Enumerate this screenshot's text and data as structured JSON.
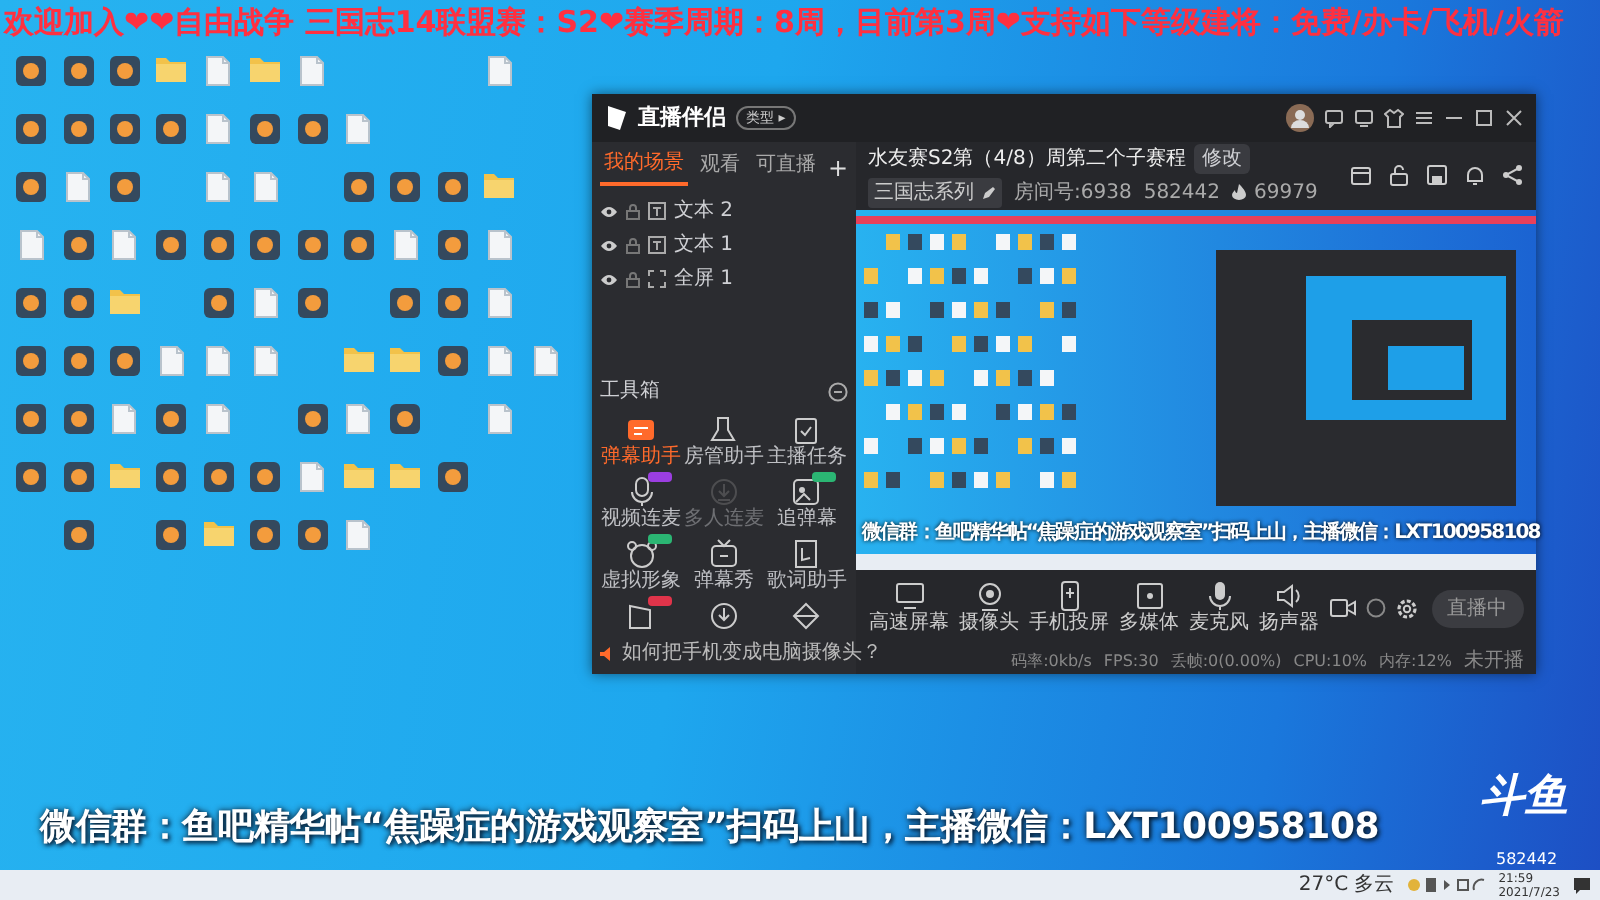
{
  "banner": "欢迎加入❤❤自由战争 三国志14联盟赛：S2❤赛季周期：8周，目前第3周❤支持如下等级建将：免费/办卡/飞机/火箭",
  "desktop_icons": [
    [
      {
        "kind": "app"
      },
      {
        "kind": "app"
      },
      {
        "kind": "app"
      },
      {
        "kind": "folder"
      },
      {
        "kind": "doc"
      },
      {
        "kind": "folder"
      },
      {
        "kind": "doc"
      },
      {
        "kind": "none"
      },
      {
        "kind": "none"
      },
      {
        "kind": "none"
      },
      {
        "kind": "doc"
      }
    ],
    [
      {
        "kind": "app"
      },
      {
        "kind": "app"
      },
      {
        "kind": "app"
      },
      {
        "kind": "app"
      },
      {
        "kind": "doc"
      },
      {
        "kind": "app"
      },
      {
        "kind": "app"
      },
      {
        "kind": "doc"
      }
    ],
    [
      {
        "kind": "app"
      },
      {
        "kind": "doc"
      },
      {
        "kind": "app"
      },
      {
        "kind": "none"
      },
      {
        "kind": "doc"
      },
      {
        "kind": "doc"
      },
      {
        "kind": "none"
      },
      {
        "kind": "app"
      },
      {
        "kind": "app"
      },
      {
        "kind": "app"
      },
      {
        "kind": "folder"
      }
    ],
    [
      {
        "kind": "doc"
      },
      {
        "kind": "app"
      },
      {
        "kind": "doc"
      },
      {
        "kind": "app"
      },
      {
        "kind": "app"
      },
      {
        "kind": "app"
      },
      {
        "kind": "app"
      },
      {
        "kind": "app"
      },
      {
        "kind": "doc"
      },
      {
        "kind": "app"
      },
      {
        "kind": "doc"
      }
    ],
    [
      {
        "kind": "app"
      },
      {
        "kind": "app"
      },
      {
        "kind": "folder"
      },
      {
        "kind": "none"
      },
      {
        "kind": "app"
      },
      {
        "kind": "doc"
      },
      {
        "kind": "app"
      },
      {
        "kind": "none"
      },
      {
        "kind": "app"
      },
      {
        "kind": "app"
      },
      {
        "kind": "doc"
      }
    ],
    [
      {
        "kind": "app"
      },
      {
        "kind": "app"
      },
      {
        "kind": "app"
      },
      {
        "kind": "doc"
      },
      {
        "kind": "doc"
      },
      {
        "kind": "doc"
      },
      {
        "kind": "none"
      },
      {
        "kind": "folder"
      },
      {
        "kind": "folder"
      },
      {
        "kind": "app"
      },
      {
        "kind": "doc"
      },
      {
        "kind": "doc"
      }
    ],
    [
      {
        "kind": "app"
      },
      {
        "kind": "app"
      },
      {
        "kind": "doc"
      },
      {
        "kind": "app"
      },
      {
        "kind": "doc"
      },
      {
        "kind": "none"
      },
      {
        "kind": "app"
      },
      {
        "kind": "doc"
      },
      {
        "kind": "app"
      },
      {
        "kind": "none"
      },
      {
        "kind": "doc"
      }
    ],
    [
      {
        "kind": "app"
      },
      {
        "kind": "app"
      },
      {
        "kind": "folder"
      },
      {
        "kind": "app"
      },
      {
        "kind": "app"
      },
      {
        "kind": "app"
      },
      {
        "kind": "doc"
      },
      {
        "kind": "folder"
      },
      {
        "kind": "folder"
      },
      {
        "kind": "app"
      }
    ],
    [
      {
        "kind": "none"
      },
      {
        "kind": "app"
      },
      {
        "kind": "none"
      },
      {
        "kind": "app"
      },
      {
        "kind": "folder"
      },
      {
        "kind": "app"
      },
      {
        "kind": "app"
      },
      {
        "kind": "doc"
      }
    ]
  ],
  "app": {
    "name": "直播伴侣",
    "badge": "类型 ▸",
    "tabs": [
      {
        "label": "我的场景",
        "selected": true
      },
      {
        "label": "观看",
        "selected": false
      },
      {
        "label": "可直播",
        "selected": false
      }
    ],
    "add": "+",
    "scenes": [
      {
        "kind": "text",
        "label": "文本 2"
      },
      {
        "kind": "text",
        "label": "文本 1"
      },
      {
        "kind": "fullscreen",
        "label": "全屏 1"
      }
    ],
    "toolbox": "工具箱",
    "tools": [
      {
        "label": "弹幕助手",
        "selected": true,
        "disabled": false
      },
      {
        "label": "房管助手",
        "selected": false,
        "disabled": false
      },
      {
        "label": "主播任务",
        "selected": false,
        "disabled": false
      },
      {
        "label": "视频连麦",
        "selected": false,
        "disabled": false,
        "color": "#9b3ee0"
      },
      {
        "label": "多人连麦",
        "selected": false,
        "disabled": true
      },
      {
        "label": "追弹幕",
        "selected": false,
        "disabled": false,
        "color": "#2bb673"
      },
      {
        "label": "虚拟形象",
        "selected": false,
        "disabled": false,
        "color": "#2bb673"
      },
      {
        "label": "弹幕秀",
        "selected": false,
        "disabled": false
      },
      {
        "label": "歌词助手",
        "selected": false,
        "disabled": false
      },
      {
        "kind": "flag",
        "color": "#e0344a"
      },
      {
        "kind": "download"
      },
      {
        "kind": "pyramid"
      }
    ],
    "tip": "如何把手机变成电脑摄像头？",
    "title": "水友赛S2第（4/8）周第二个子赛程",
    "edit": "修改",
    "category": "三国志系列",
    "room": "房间号:6938",
    "viewers": "582442",
    "heat": "69979",
    "preview_caption": "微信群：鱼吧精华帖“焦躁症的游戏观察室”扫码上山，主播微信：LXT100958108",
    "controls": [
      {
        "kind": "screen",
        "label": "高速屏幕"
      },
      {
        "kind": "camera",
        "label": "摄像头"
      },
      {
        "kind": "phone",
        "label": "手机投屏"
      },
      {
        "kind": "media",
        "label": "多媒体"
      },
      {
        "kind": "mic",
        "label": "麦克风"
      },
      {
        "kind": "speaker",
        "label": "扬声器"
      }
    ],
    "live_button": "直播中",
    "status": [
      "码率:0kb/s",
      "FPS:30",
      "丢帧:0(0.00%)",
      "CPU:10%",
      "内存:12%",
      "未开播"
    ]
  },
  "caption": "微信群：鱼吧精华帖“焦躁症的游戏观察室”扫码上山，主播微信：LXT100958108",
  "logo": "斗鱼",
  "room_number": "582442",
  "taskbar": {
    "weather": "27°C 多云",
    "time": "21:59",
    "date": "2021/7/23"
  }
}
